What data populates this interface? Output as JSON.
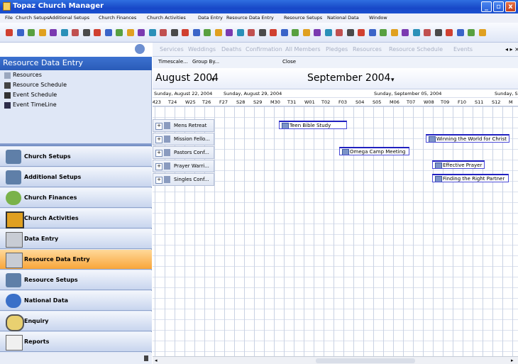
{
  "window": {
    "title": "Topaz Church Manager",
    "minimize": "_",
    "maximize": "▫",
    "close": "x"
  },
  "menu": [
    "File",
    "Church Setups",
    "Additional Setups",
    "Church Finances",
    "Church Activities",
    "Data Entry",
    "Resource Data Entry",
    "Resource Setups",
    "National Data",
    "Window"
  ],
  "left_panel": {
    "title": "Resource Data Entry",
    "items": [
      {
        "label": "Resources",
        "icon": "resources-icon"
      },
      {
        "label": "Resource Schedule",
        "icon": "schedule-icon"
      },
      {
        "label": "Event Schedule",
        "icon": "event-schedule-icon"
      },
      {
        "label": "Event TimeLine",
        "icon": "timeline-icon"
      }
    ],
    "nav": [
      {
        "label": "Church Setups",
        "icon": "people-icon"
      },
      {
        "label": "Additional Setups",
        "icon": "people-icon"
      },
      {
        "label": "Church Finances",
        "icon": "finance-icon"
      },
      {
        "label": "Church Activities",
        "icon": "activities-icon"
      },
      {
        "label": "Data Entry",
        "icon": "data-entry-icon"
      },
      {
        "label": "Resource Data Entry",
        "icon": "data-entry-icon",
        "selected": true
      },
      {
        "label": "Resource Setups",
        "icon": "people-icon"
      },
      {
        "label": "National Data",
        "icon": "pen-icon"
      },
      {
        "label": "Enquiry",
        "icon": "magnifier-icon"
      },
      {
        "label": "Reports",
        "icon": "report-icon"
      }
    ]
  },
  "tabs": [
    "Services",
    "Weddings",
    "Deaths",
    "Confirmation",
    "All Members",
    "Pledges",
    "Resources",
    "Resource Schedule",
    "Events"
  ],
  "commands": {
    "timescale": "Timescale...",
    "group_by": "Group By...",
    "close": "Close"
  },
  "calendar": {
    "months": [
      "August 2004",
      "September 2004"
    ],
    "weeks": [
      "Sunday, August 22, 2004",
      "Sunday, August 29, 2004",
      "Sunday, September 05, 2004",
      "Sunday, S"
    ],
    "days": [
      "M23",
      "T24",
      "W25",
      "T26",
      "F27",
      "S28",
      "S29",
      "M30",
      "T31",
      "W01",
      "T02",
      "F03",
      "S04",
      "S05",
      "M06",
      "T07",
      "W08",
      "T09",
      "F10",
      "S11",
      "S12",
      "M"
    ],
    "resources": [
      "Mens Retreat",
      "Mission Fello...",
      "Pastors Conf...",
      "Prayer Warri...",
      "Singles Conf..."
    ],
    "events": [
      {
        "label": "Teen Bible Study"
      },
      {
        "label": "Winning the World for Christ"
      },
      {
        "label": "Omega Camp Meeting"
      },
      {
        "label": "Effective Prayer"
      },
      {
        "label": "Finding the Right Partner"
      }
    ]
  },
  "colors": {
    "title_bar": "#1848c8",
    "panel_title": "#2a5bb8",
    "selected_nav": "#f8a53a",
    "event_border": "#2020c0"
  }
}
